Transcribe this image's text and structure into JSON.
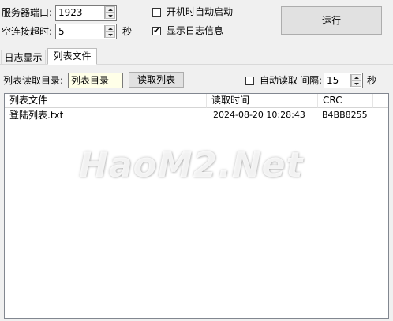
{
  "server": {
    "port_label": "服务器端口:",
    "port_value": "1923",
    "timeout_label": "空连接超时:",
    "timeout_value": "5",
    "timeout_unit": "秒",
    "autostart_label": "开机时自动启动",
    "autostart_checked": false,
    "showlog_label": "显示日志信息",
    "showlog_checked": true,
    "run_button": "运行"
  },
  "tabs": [
    {
      "label": "日志显示",
      "active": false
    },
    {
      "label": "列表文件",
      "active": true
    }
  ],
  "list_panel": {
    "dir_label": "列表读取目录:",
    "dir_value": "列表目录",
    "read_button": "读取列表",
    "auto_read_label": "自动读取",
    "auto_read_checked": false,
    "interval_label": "间隔:",
    "interval_value": "15",
    "interval_unit": "秒"
  },
  "table": {
    "columns": [
      "列表文件",
      "读取时间",
      "CRC"
    ],
    "rows": [
      [
        "登陆列表.txt",
        "2024-08-20 10:28:43",
        "B4BB8255"
      ]
    ]
  },
  "watermark": "HaoM2.Net"
}
